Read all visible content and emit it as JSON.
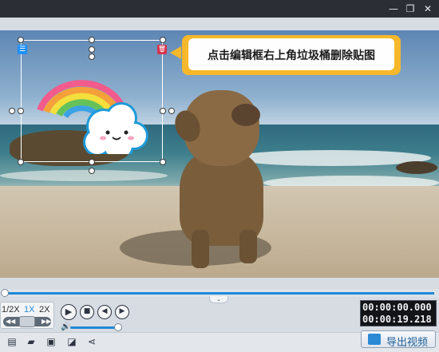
{
  "titlebar": {
    "minimize_icon": "minimize-icon",
    "restore_icon": "restore-icon"
  },
  "sticker": {
    "menu_icon": "list-icon",
    "delete_icon": "trash-icon"
  },
  "tooltip": {
    "text": "点击编辑框右上角垃圾桶删除贴图"
  },
  "timeline": {
    "progress": 0.0
  },
  "playback": {
    "speeds": [
      "1/2X",
      "1X",
      "2X"
    ],
    "selected_speed": "1X",
    "jog_left": "◀◀",
    "jog_right": "▶▶",
    "buttons": [
      "play-icon",
      "stop-icon",
      "step-back-icon",
      "step-forward-icon"
    ]
  },
  "volume": {
    "level": 0.9
  },
  "time": {
    "current": "00:00:00.000",
    "total": "00:00:19.218"
  },
  "toolbar": {
    "icons": [
      "new-file-icon",
      "open-folder-icon",
      "save-icon",
      "save-as-icon",
      "share-icon"
    ],
    "export_label": "导出视频"
  },
  "colors": {
    "accent": "#1e89d8",
    "tooltip_border": "#f6b82a",
    "delete": "#d6334c"
  }
}
